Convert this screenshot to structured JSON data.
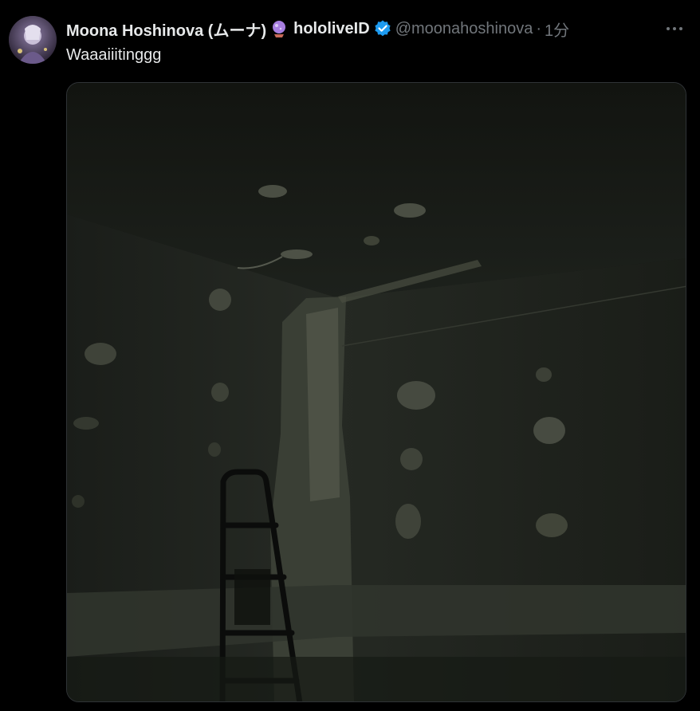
{
  "tweet": {
    "display_name": "Moona Hoshinova (ムーナ)",
    "affiliation": "hololiveID",
    "handle": "@moonahoshinova",
    "separator": "·",
    "time": "1分",
    "text": "Waaaiiitinggg",
    "icons": {
      "emoji": "crystal-ball-icon",
      "verified": "verified-badge-icon",
      "more": "more-options-icon"
    },
    "colors": {
      "background": "#000000",
      "text": "#e7e9ea",
      "secondary": "#71767b",
      "verified": "#1d9bf0"
    }
  }
}
